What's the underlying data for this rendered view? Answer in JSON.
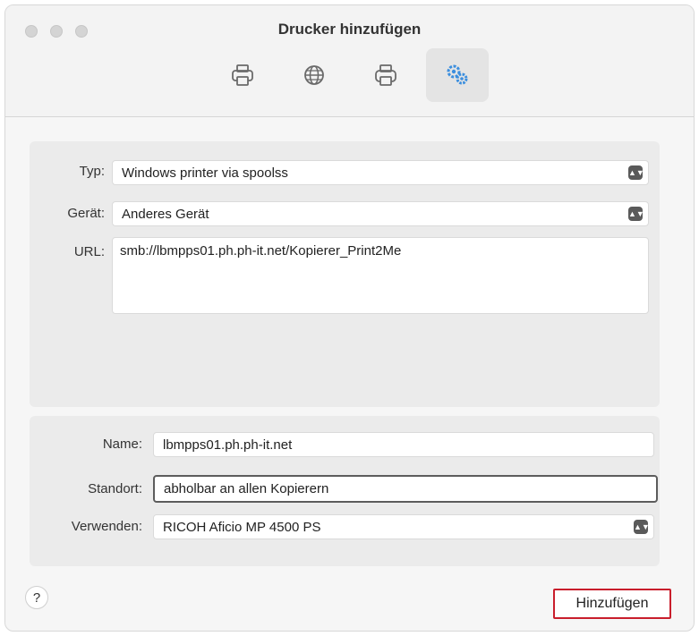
{
  "window": {
    "title": "Drucker hinzufügen"
  },
  "toolbar": {
    "items": [
      {
        "icon": "printer-default-icon",
        "active": false
      },
      {
        "icon": "globe-ip-icon",
        "active": false
      },
      {
        "icon": "windows-printer-icon",
        "active": false
      },
      {
        "icon": "advanced-gears-icon",
        "active": true
      }
    ]
  },
  "connection": {
    "type_label": "Typ:",
    "type_value": "Windows printer via spoolss",
    "device_label": "Gerät:",
    "device_value": "Anderes Gerät",
    "url_label": "URL:",
    "url_value": "smb://lbmpps01.ph.ph-it.net/Kopierer_Print2Me"
  },
  "details": {
    "name_label": "Name:",
    "name_value": "lbmpps01.ph.ph-it.net",
    "location_label": "Standort:",
    "location_value": "abholbar an allen Kopierern",
    "use_label": "Verwenden:",
    "use_value": "RICOH Aficio MP 4500 PS"
  },
  "footer": {
    "help_label": "?",
    "add_label": "Hinzufügen"
  },
  "colors": {
    "highlight_border": "#c91e2c",
    "active_icon": "#3b8ede"
  }
}
